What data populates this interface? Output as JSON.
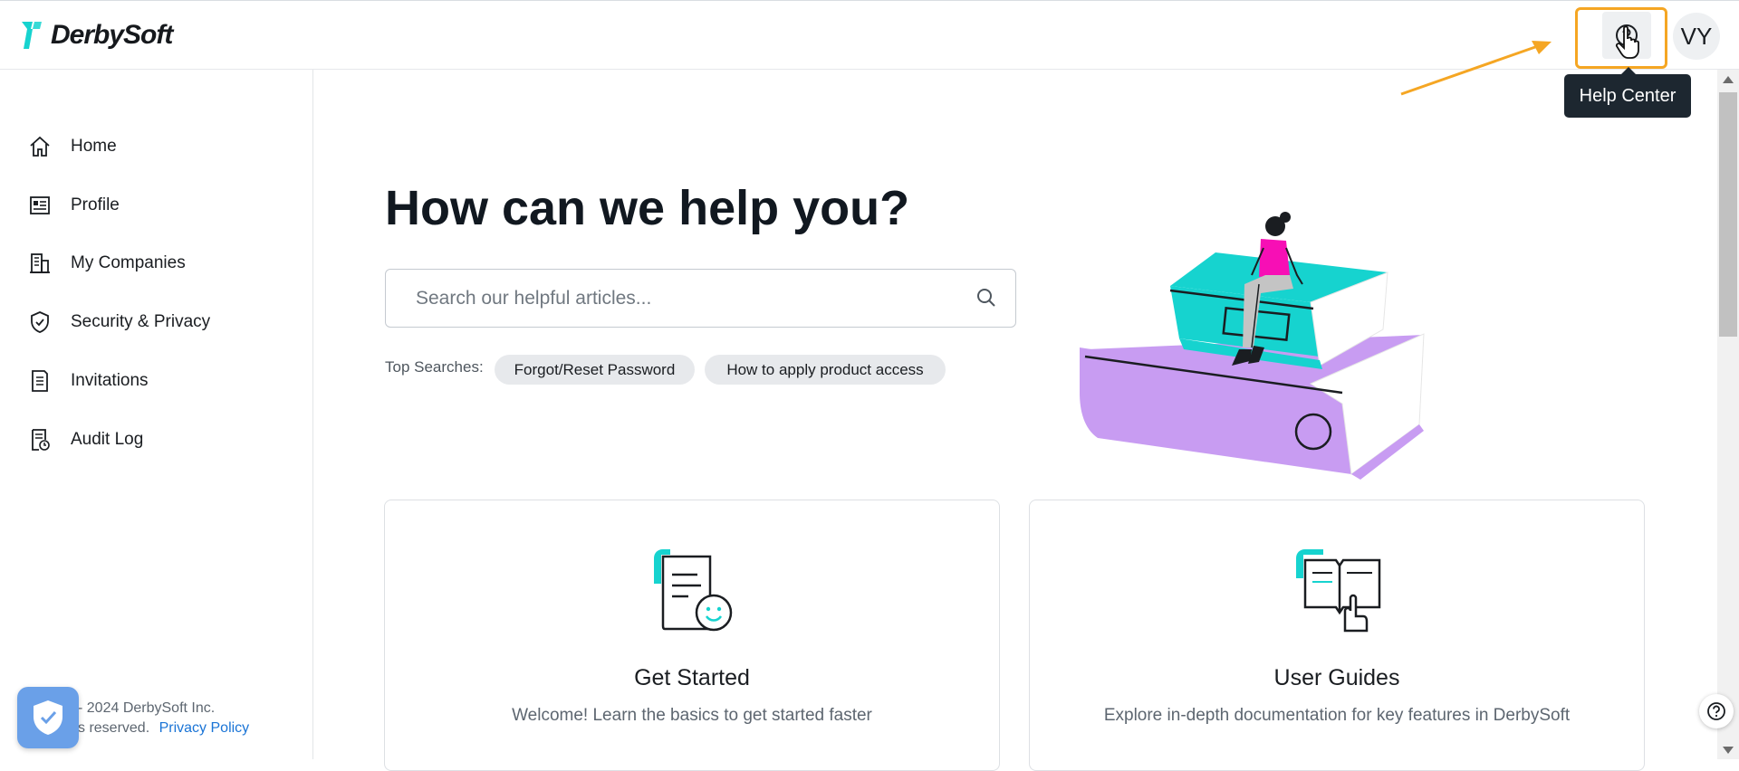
{
  "brand": {
    "name": "DerbySoft",
    "accent": "#16d3cf"
  },
  "header": {
    "avatar_initials": "VY",
    "help_tooltip": "Help Center",
    "highlight_color": "#f5a623"
  },
  "sidebar": {
    "items": [
      {
        "label": "Home",
        "icon": "home-icon"
      },
      {
        "label": "Profile",
        "icon": "profile-card-icon"
      },
      {
        "label": "My Companies",
        "icon": "building-icon"
      },
      {
        "label": "Security & Privacy",
        "icon": "shield-check-icon"
      },
      {
        "label": "Invitations",
        "icon": "document-list-icon"
      },
      {
        "label": "Audit Log",
        "icon": "audit-log-icon"
      }
    ],
    "footer_line1": "- 2024 DerbySoft Inc.",
    "footer_line2": "s reserved.",
    "privacy_link": "Privacy Policy"
  },
  "main": {
    "title": "How can we help you?",
    "search_placeholder": "Search our helpful articles...",
    "top_searches_label": "Top Searches:",
    "chips": [
      "Forgot/Reset Password",
      "How to apply product access"
    ],
    "cards": [
      {
        "title": "Get Started",
        "description": "Welcome! Learn the basics to get started faster",
        "icon": "get-started-icon"
      },
      {
        "title": "User Guides",
        "description": "Explore in-depth documentation for key features in DerbySoft",
        "icon": "user-guide-icon"
      }
    ]
  }
}
